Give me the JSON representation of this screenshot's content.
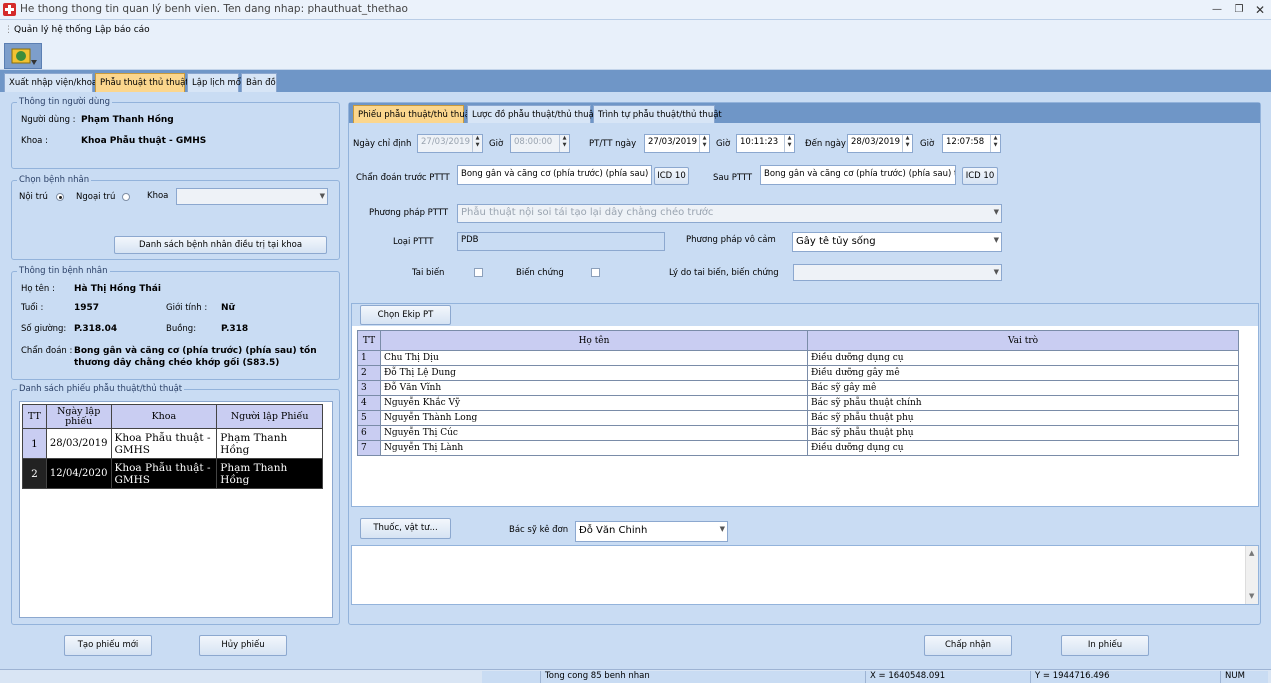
{
  "window": {
    "title": "He thong thong tin quan lý benh vien. Ten dang nhap: phauthuat_thethao"
  },
  "menu": {
    "items": [
      "Quản lý hệ thống",
      "Lập báo cáo"
    ]
  },
  "main_tabs": [
    "Xuất nhập viện/khoa",
    "Phẫu thuật thủ thuật",
    "Lập lịch mổ",
    "Bản đồ"
  ],
  "user_info": {
    "group_label": "Thông tin người dùng",
    "user_label": "Người dùng :",
    "user_value": "Phạm Thanh Hồng",
    "dept_label": "Khoa :",
    "dept_value": "Khoa Phẫu thuật - GMHS"
  },
  "patient_select": {
    "group_label": "Chọn bệnh nhân",
    "inpatient": "Nội trú",
    "outpatient": "Ngoại trú",
    "dept": "Khoa",
    "list_button": "Danh sách bệnh nhân điều trị tại khoa"
  },
  "patient_info": {
    "group_label": "Thông tin bệnh nhân",
    "name_label": "Họ tên :",
    "name": "Hà Thị Hồng Thái",
    "age_label": "Tuổi :",
    "age": "1957",
    "gender_label": "Giới tính :",
    "gender": "Nữ",
    "bed_label": "Số giường:",
    "bed": "P.318.04",
    "room_label": "Buồng:",
    "room": "P.318",
    "diag_label": "Chẩn đoán :",
    "diagnosis": "Bong gân và căng cơ (phía trước) (phía sau) tồn thương dây chằng chéo khớp gối (S83.5)"
  },
  "form_list": {
    "group_label": "Danh sách phiếu phẫu thuật/thủ thuật",
    "headers": [
      "TT",
      "Ngày lập phiếu",
      "Khoa",
      "Người lập Phiếu"
    ],
    "rows": [
      {
        "tt": "1",
        "date": "28/03/2019",
        "dept": "Khoa Phẫu thuật - GMHS",
        "creator": "Phạm Thanh Hồng"
      },
      {
        "tt": "2",
        "date": "12/04/2020",
        "dept": "Khoa Phẫu thuật - GMHS",
        "creator": "Phạm Thanh Hồng"
      }
    ]
  },
  "bottom_buttons": {
    "new": "Tạo phiếu mới",
    "cancel": "Hủy phiếu",
    "accept": "Chấp nhận",
    "print": "In phiếu"
  },
  "detail_tabs": [
    "Phiếu phẫu thuật/thủ thuật",
    "Lược đồ phẫu thuật/thủ thuật",
    "Trình tự phẫu thuật/thủ thuật"
  ],
  "form": {
    "assign_date_label": "Ngày chỉ định",
    "assign_date": "27/03/2019",
    "time_label": "Giờ",
    "assign_time": "08:00:00",
    "pt_date_label": "PT/TT ngày",
    "pt_date": "27/03/2019",
    "pt_time": "10:11:23",
    "to_date_label": "Đến ngày",
    "to_date": "28/03/2019",
    "to_time": "12:07:58",
    "pre_diag_label": "Chẩn đoán trước PTTT",
    "pre_diag": "Bong gân và căng cơ (phía trước) (phía sau) tổ",
    "icd_button": "ICD 10",
    "post_label": "Sau PTTT",
    "post_diag": "Bong gân và căng cơ (phía trước) (phía sau) tổ",
    "method_label": "Phương pháp PTTT",
    "method": "Phẫu thuật nội soi tái tạo lại dây chằng chéo trước",
    "type_label": "Loại PTTT",
    "type": "PDB",
    "anesthesia_label": "Phương pháp vô cảm",
    "anesthesia": "Gây tê tủy sống",
    "accident_label": "Tai biến",
    "complication_label": "Biến chứng",
    "reason_label": "Lý do tai biến, biến chứng"
  },
  "team": {
    "button": "Chọn Ekip PT",
    "headers": [
      "TT",
      "Họ tên",
      "Vai trò"
    ],
    "rows": [
      {
        "tt": "1",
        "name": "Chu Thị Dịu",
        "role": "Điều dưỡng dụng cụ"
      },
      {
        "tt": "2",
        "name": "Đỗ Thị Lệ Dung",
        "role": "Điều dưỡng gây mê"
      },
      {
        "tt": "3",
        "name": "Đỗ Văn Vĩnh",
        "role": "Bác sỹ gây mê"
      },
      {
        "tt": "4",
        "name": "Nguyễn Khắc Vỹ",
        "role": "Bác sỹ phẫu thuật chính"
      },
      {
        "tt": "5",
        "name": "Nguyễn Thành Long",
        "role": "Bác sỹ phẫu thuật phụ"
      },
      {
        "tt": "6",
        "name": "Nguyễn Thị Cúc",
        "role": "Bác sỹ phẫu thuật phụ"
      },
      {
        "tt": "7",
        "name": "Nguyễn Thị Lành",
        "role": "Điều dưỡng dụng cụ"
      }
    ]
  },
  "prescription": {
    "button": "Thuốc, vật tư...",
    "doctor_label": "Bác sỹ kê đơn",
    "doctor": "Đỗ Văn Chinh"
  },
  "status": {
    "count": "Tong cong 85 benh nhan",
    "x": "X = 1640548.091",
    "y": "Y = 1944716.496",
    "num": "NUM"
  }
}
